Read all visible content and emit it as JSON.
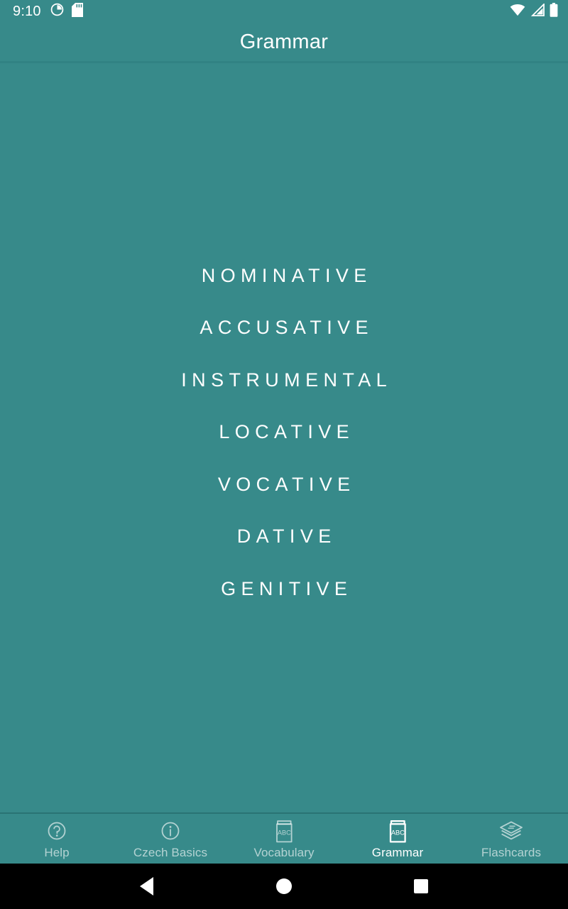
{
  "status_bar": {
    "time": "9:10",
    "left_icons": [
      "data-usage-icon",
      "sd-card-icon"
    ],
    "right_icons": [
      "wifi-icon",
      "cellular-signal-icon",
      "battery-icon"
    ]
  },
  "app_bar": {
    "title": "Grammar"
  },
  "theme": {
    "background": "#378A8A",
    "app_bar": "#378A8A",
    "divider": "#2E7B7D",
    "text": "#ffffff",
    "inactive_text": "rgba(255,255,255,0.62)",
    "system_nav": "#000000"
  },
  "main": {
    "cases": [
      {
        "label": "NOMINATIVE"
      },
      {
        "label": "ACCUSATIVE"
      },
      {
        "label": "INSTRUMENTAL"
      },
      {
        "label": "LOCATIVE"
      },
      {
        "label": "VOCATIVE"
      },
      {
        "label": "DATIVE"
      },
      {
        "label": "GENITIVE"
      }
    ]
  },
  "bottom_nav": {
    "active_index": 3,
    "items": [
      {
        "label": "Help",
        "icon": "question-circle-icon"
      },
      {
        "label": "Czech Basics",
        "icon": "info-circle-icon"
      },
      {
        "label": "Vocabulary",
        "icon": "abc-book-icon"
      },
      {
        "label": "Grammar",
        "icon": "abc-book-icon"
      },
      {
        "label": "Flashcards",
        "icon": "stacked-cards-icon"
      }
    ]
  },
  "system_nav": {
    "buttons": [
      "back-button",
      "home-button",
      "recents-button"
    ]
  }
}
